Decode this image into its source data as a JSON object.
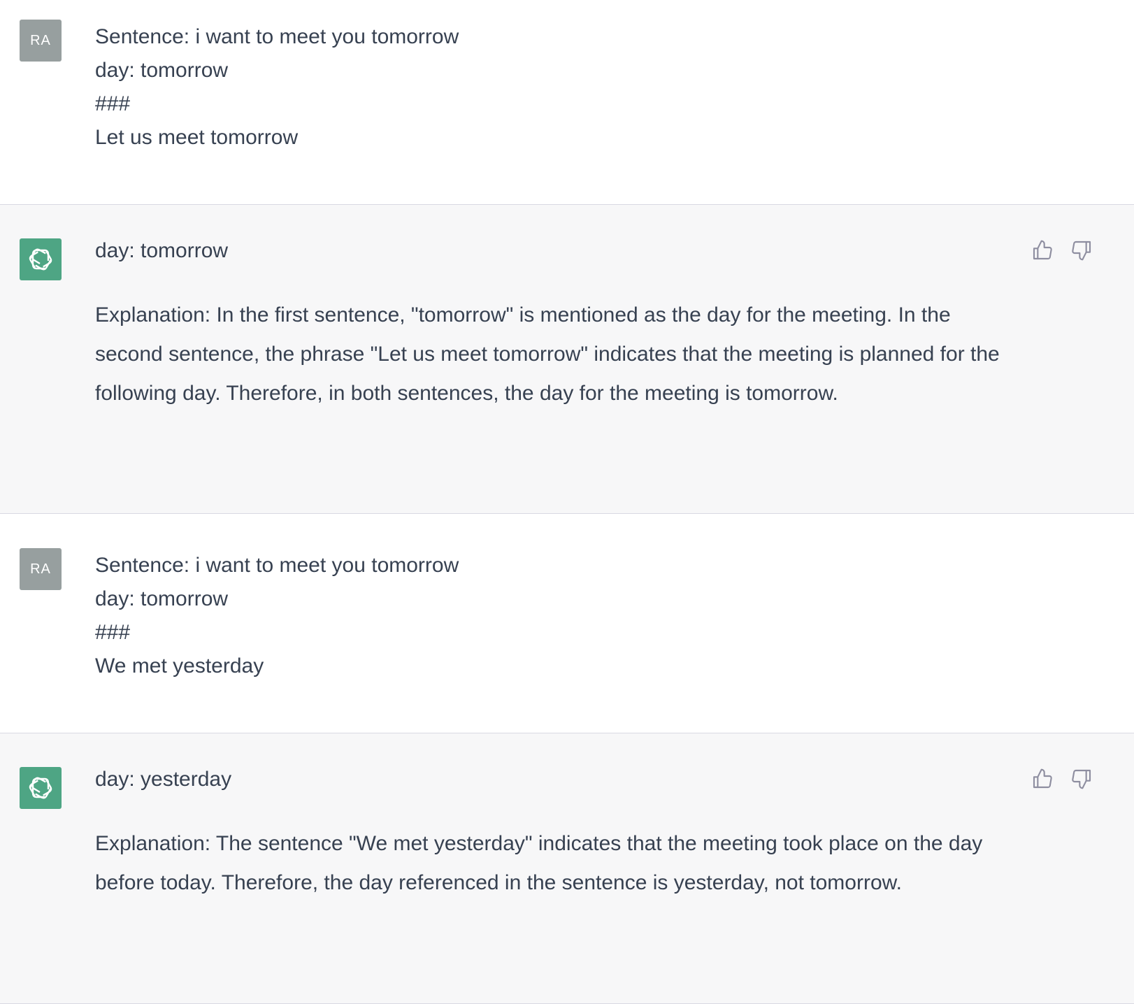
{
  "thread": {
    "messages": [
      {
        "role": "user",
        "avatar_text": "RA",
        "lines": [
          "Sentence: i want to meet you tomorrow",
          "day: tomorrow",
          "###",
          "Let us meet tomorrow"
        ]
      },
      {
        "role": "assistant",
        "avatar_icon": "openai-logo-icon",
        "answer": "day: tomorrow",
        "explanation": "Explanation: In the first sentence, \"tomorrow\" is mentioned as the day for the meeting. In the second sentence, the phrase \"Let us meet tomorrow\" indicates that the meeting is planned for the following day. Therefore, in both sentences, the day for the meeting is tomorrow.",
        "feedback_icons": [
          "thumbs-up-icon",
          "thumbs-down-icon"
        ]
      },
      {
        "role": "user",
        "avatar_text": "RA",
        "lines": [
          "Sentence: i want to meet you tomorrow",
          "day: tomorrow",
          "###",
          "We met yesterday"
        ]
      },
      {
        "role": "assistant",
        "avatar_icon": "openai-logo-icon",
        "answer": "day: yesterday",
        "explanation": "Explanation: The sentence \"We met yesterday\" indicates that the meeting took place on the day before today. Therefore, the day referenced in the sentence is yesterday, not tomorrow.",
        "feedback_icons": [
          "thumbs-up-icon",
          "thumbs-down-icon"
        ]
      }
    ]
  },
  "colors": {
    "user_bg": "#ffffff",
    "assistant_bg": "#f7f7f8",
    "user_avatar": "#979f9f",
    "assistant_avatar": "#4ea584",
    "text": "#374151",
    "divider": "#d9d9e3"
  }
}
